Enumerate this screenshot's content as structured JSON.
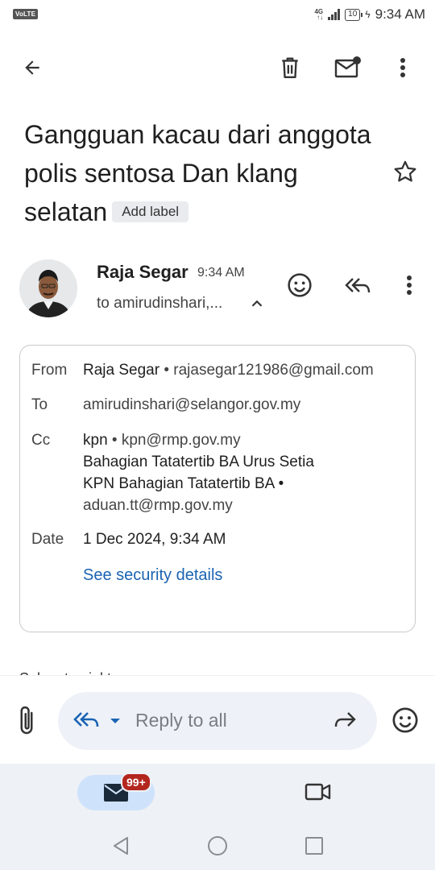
{
  "status_bar": {
    "volte": "VoLTE",
    "network": "4G",
    "battery": "10",
    "time": "9:34 AM"
  },
  "app_bar": {
    "icons": [
      "back-arrow-icon",
      "trash-icon",
      "mark-unread-icon",
      "more-vert-icon"
    ]
  },
  "email": {
    "subject": "Gangguan kacau dari anggota polis sentosa Dan klang selatan",
    "add_label": "Add label",
    "sender_name": "Raja Segar",
    "time": "9:34 AM",
    "to_summary": "to amirudinshari,...",
    "details": {
      "from_label": "From",
      "from_name": "Raja Segar",
      "from_email": "rajasegar121986@gmail.com",
      "to_label": "To",
      "to_value": "amirudinshari@selangor.gov.my",
      "cc_label": "Cc",
      "cc_line1_name": "kpn",
      "cc_line1_email": "kpn@rmp.gov.my",
      "cc_line2": "Bahagian Tatatertib BA Urus Setia",
      "cc_line3": "KPN Bahagian Tatatertib BA •",
      "cc_line4": "aduan.tt@rmp.gov.my",
      "date_label": "Date",
      "date_value": "1 Dec 2024, 9:34 AM",
      "security_link": "See security details"
    },
    "body_cutoff": "Salam  to  pial  to"
  },
  "reply_bar": {
    "placeholder": "Reply to all"
  },
  "bottom_nav": {
    "mail_badge": "99+"
  },
  "colors": {
    "link": "#1a63b3",
    "reply_icon": "#1a63b3",
    "pill_bg": "#eef2f8",
    "nav_bg": "#eef1f6",
    "mail_pill": "#cfe2fb",
    "badge": "#b3261e"
  }
}
